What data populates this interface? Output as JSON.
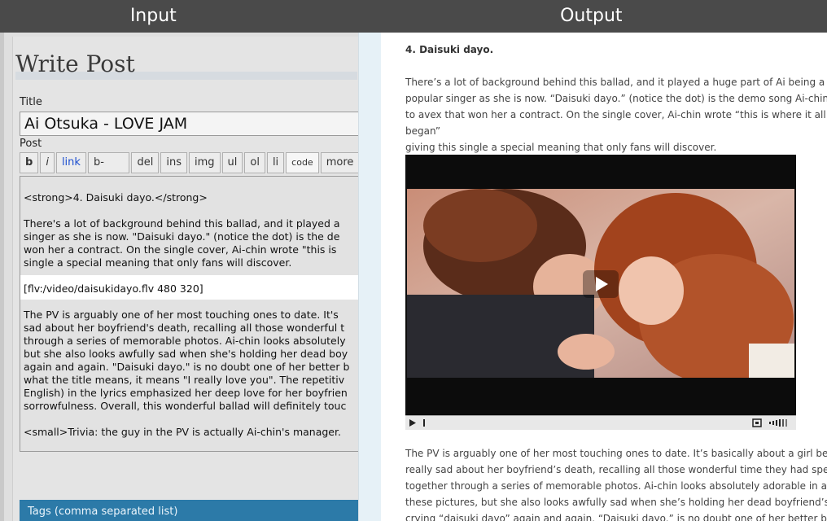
{
  "topbar": {
    "input_label": "Input",
    "output_label": "Output"
  },
  "editor_page": {
    "page_title": "Write Post",
    "title_label": "Title",
    "title_value": "Ai Otsuka - LOVE JAM",
    "post_label": "Post",
    "toolbar": [
      "b",
      "i",
      "link",
      "b-quote",
      "del",
      "ins",
      "img",
      "ul",
      "ol",
      "li",
      "code",
      "more"
    ],
    "content_lines": {
      "l1": "<strong>4. Daisuki dayo.</strong>",
      "l2": "There's a lot of background behind this ballad, and it played a",
      "l3": "singer as she is now. \"Daisuki dayo.\" (notice the dot) is the de",
      "l4": "won her a contract. On the single cover, Ai-chin wrote \"this is",
      "l5": "single a special meaning that only fans will discover.",
      "l6": "[flv:/video/daisukidayo.flv 480 320]",
      "l7": "The PV is arguably one of her most touching ones to date. It's",
      "l8": "sad about her boyfriend's death, recalling all those wonderful t",
      "l9": "through a series of memorable photos. Ai-chin looks absolutely",
      "l10": "but she also looks awfully sad when she's holding her dead boy",
      "l11": "again and again. \"Daisuki dayo.\" is no doubt one of her better b",
      "l12": "what the title means, it means \"I really love you\". The repetitiv",
      "l13": "English) in the lyrics emphasized her deep love for her boyfrien",
      "l14": "sorrowfulness. Overall, this wonderful ballad will definitely touc",
      "l15": "<small>Trivia: the guy in the PV is actually Ai-chin's manager."
    },
    "tags_label": "Tags (comma separated list)"
  },
  "output_page": {
    "heading": "4. Daisuki dayo.",
    "p1": [
      "There’s a lot of background behind this ballad, and it played a huge part of Ai being a",
      "popular singer as she is now. “Daisuki dayo.” (notice the dot) is the demo song Ai-chin sent",
      "to avex that won her a contract. On the single cover, Ai-chin wrote “this is where it all began”",
      "giving this single a special meaning that only fans will discover."
    ],
    "p2": [
      "The PV is arguably one of her most touching ones to date. It’s basically about a girl being",
      "really sad about her boyfriend’s death, recalling all those wonderful time they had spent",
      "together through a series of memorable photos. Ai-chin looks absolutely adorable in all of",
      "these pictures, but she also looks awfully sad when she’s holding her dead boyfriend’s hand,",
      "crying “daisuki dayo” again and again. “Daisuki dayo.” is no doubt one of her better ballads."
    ]
  },
  "colors": {
    "accent": "#2c7aa8",
    "link": "#1d4fd0"
  }
}
